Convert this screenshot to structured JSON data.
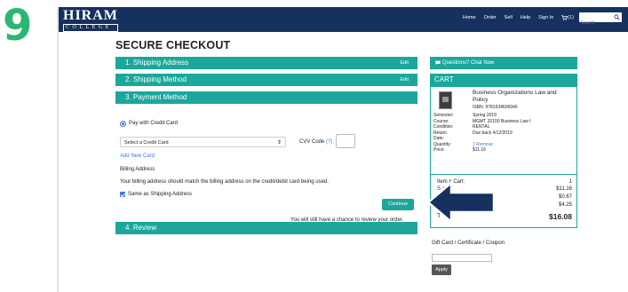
{
  "step_number": "9",
  "logo": {
    "top": "HIRAM",
    "sub": "COLLEGE"
  },
  "nav": {
    "items": [
      "Home",
      "Order",
      "Sell",
      "Help",
      "Sign In"
    ],
    "cart_count": "(1)",
    "search_placeholder": "Search"
  },
  "page_title": "SECURE CHECKOUT",
  "steps": {
    "shipping_address": {
      "label": "1. Shipping Address",
      "edit": "Edit"
    },
    "shipping_method": {
      "label": "2. Shipping Method",
      "edit": "Edit"
    },
    "payment_method": {
      "label": "3. Payment Method"
    },
    "review": {
      "label": "4. Review"
    }
  },
  "payment": {
    "pay_option": "Pay with Credit Card",
    "select_card": "Select a Credit Card",
    "cvv_label": "CVV Code",
    "cvv_help": "(?)",
    "add_card": "Add New Card",
    "billing_heading": "Billing Address",
    "billing_note": "Your billing address should match the billing address on the credit/debit card being used.",
    "same_as_shipping": "Same as Shipping Address",
    "continue": "Continue",
    "review_note": "You will still have a chance to review your order."
  },
  "sidebar": {
    "chat": "Questions? Chat Now",
    "cart_title": "CART",
    "item": {
      "title": "Business Organizations Law and Policy",
      "isbn": "ISBN: 9781634605946",
      "details": [
        {
          "k": "Semester:",
          "v": "Spring 2019"
        },
        {
          "k": "Course:",
          "v": "MGMT 32100 Business Law I"
        },
        {
          "k": "Condition:",
          "v": "RENTAL"
        },
        {
          "k": "Return",
          "v": "Due back 4/12/2019"
        },
        {
          "k": "Date:",
          "v": ""
        },
        {
          "k": "Quantity:",
          "v": "1 Remove"
        },
        {
          "k": "Price:",
          "v": "$11.16"
        }
      ]
    },
    "totals": {
      "items_label": "Item   n Cart:",
      "items_value": "1",
      "sub_label": "S         al:",
      "sub_value": "$11.16",
      "tax_value": "$0.67",
      "ship_value": "$4.25",
      "total_label": "T",
      "total_value": "$16.08"
    },
    "gift_label": "Gift Card / Certificate / Coupon",
    "apply": "Apply"
  },
  "colors": {
    "navy": "#16305f",
    "teal": "#1ba79b",
    "step_green": "#2bb673",
    "arrow": "#16305f"
  }
}
